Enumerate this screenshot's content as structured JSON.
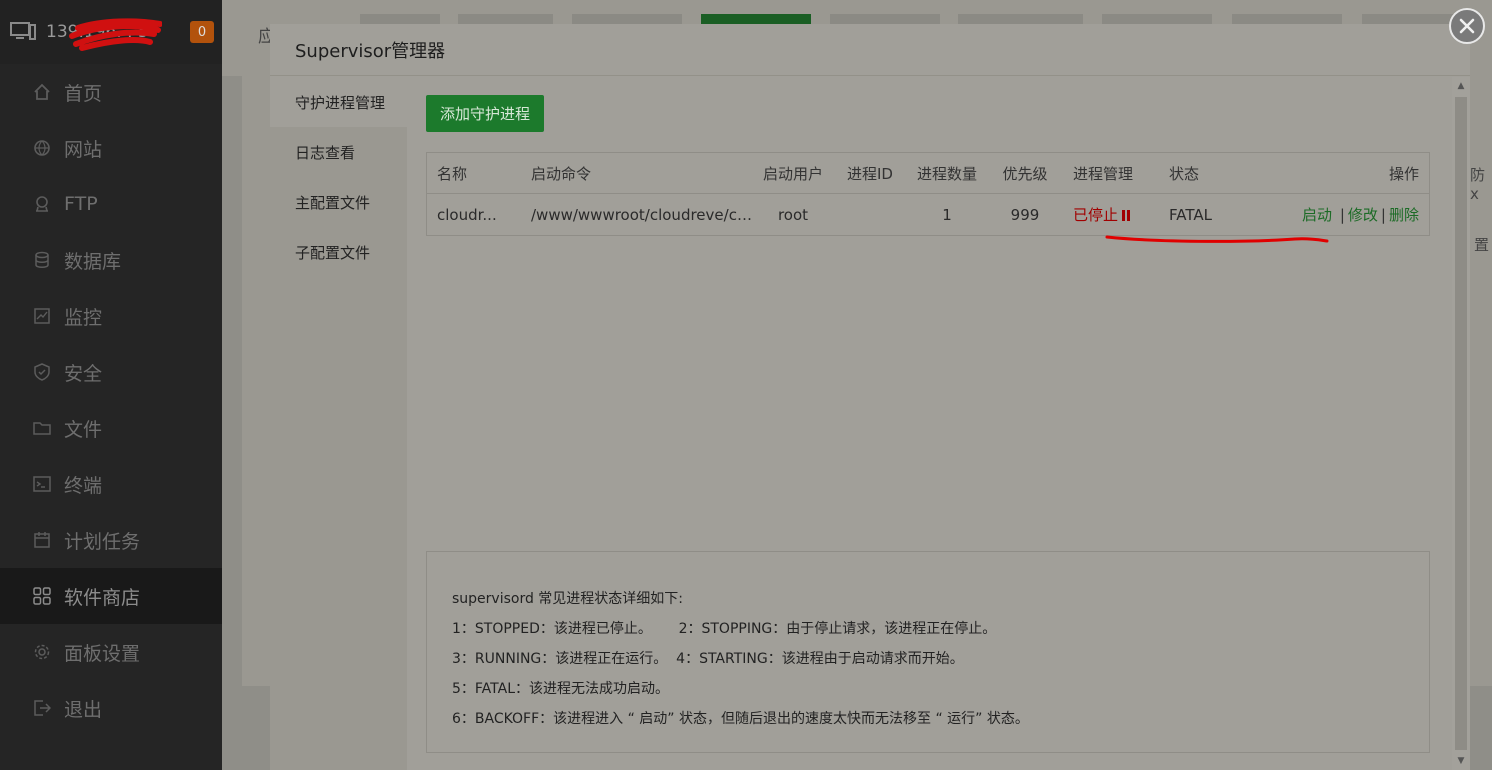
{
  "sidebar": {
    "host_ip": "139.196.  .  5",
    "notification_count": "0",
    "items": [
      {
        "label": "首页",
        "icon": "home-icon"
      },
      {
        "label": "网站",
        "icon": "globe-icon"
      },
      {
        "label": "FTP",
        "icon": "ftp-icon"
      },
      {
        "label": "数据库",
        "icon": "database-icon"
      },
      {
        "label": "监控",
        "icon": "monitor-icon"
      },
      {
        "label": "安全",
        "icon": "shield-icon"
      },
      {
        "label": "文件",
        "icon": "folder-icon"
      },
      {
        "label": "终端",
        "icon": "terminal-icon"
      },
      {
        "label": "计划任务",
        "icon": "calendar-icon"
      },
      {
        "label": "软件商店",
        "icon": "grid-icon"
      },
      {
        "label": "面板设置",
        "icon": "gear-icon"
      },
      {
        "label": "退出",
        "icon": "logout-icon"
      }
    ],
    "active_item": "软件商店"
  },
  "background": {
    "tab_char": "应",
    "right_text_1": "防x",
    "right_text_2": "置"
  },
  "modal": {
    "title": "Supervisor管理器",
    "tabs": [
      "守护进程管理",
      "日志查看",
      "主配置文件",
      "子配置文件"
    ],
    "active_tab": "守护进程管理",
    "add_button": "添加守护进程",
    "table": {
      "headers": {
        "name": "名称",
        "command": "启动命令",
        "user": "启动用户",
        "pid": "进程ID",
        "count": "进程数量",
        "priority": "优先级",
        "manage": "进程管理",
        "state": "状态",
        "ops": "操作"
      },
      "rows": [
        {
          "name": "cloudr...",
          "command": "/www/wwwroot/cloudreve/cl...",
          "user": "root",
          "pid": "",
          "count": "1",
          "priority": "999",
          "manage": "已停止",
          "state": "FATAL",
          "op_start": "启动",
          "op_edit": "修改",
          "op_delete": "删除"
        }
      ]
    },
    "notes": [
      "supervisord 常见进程状态详细如下:",
      "1：STOPPED：该进程已停止。      2：STOPPING：由于停止请求，该进程正在停止。",
      "3：RUNNING：该进程正在运行。  4：STARTING：该进程由于启动请求而开始。",
      "5：FATAL：该进程无法成功启动。",
      "6：BACKOFF：该进程进入 “ 启动” 状态，但随后退出的速度太快而无法移至 “ 运行” 状态。"
    ]
  },
  "colors": {
    "accent_green": "#20a53a",
    "stopped_red": "#cc0000",
    "annotation_red": "#e00000"
  }
}
